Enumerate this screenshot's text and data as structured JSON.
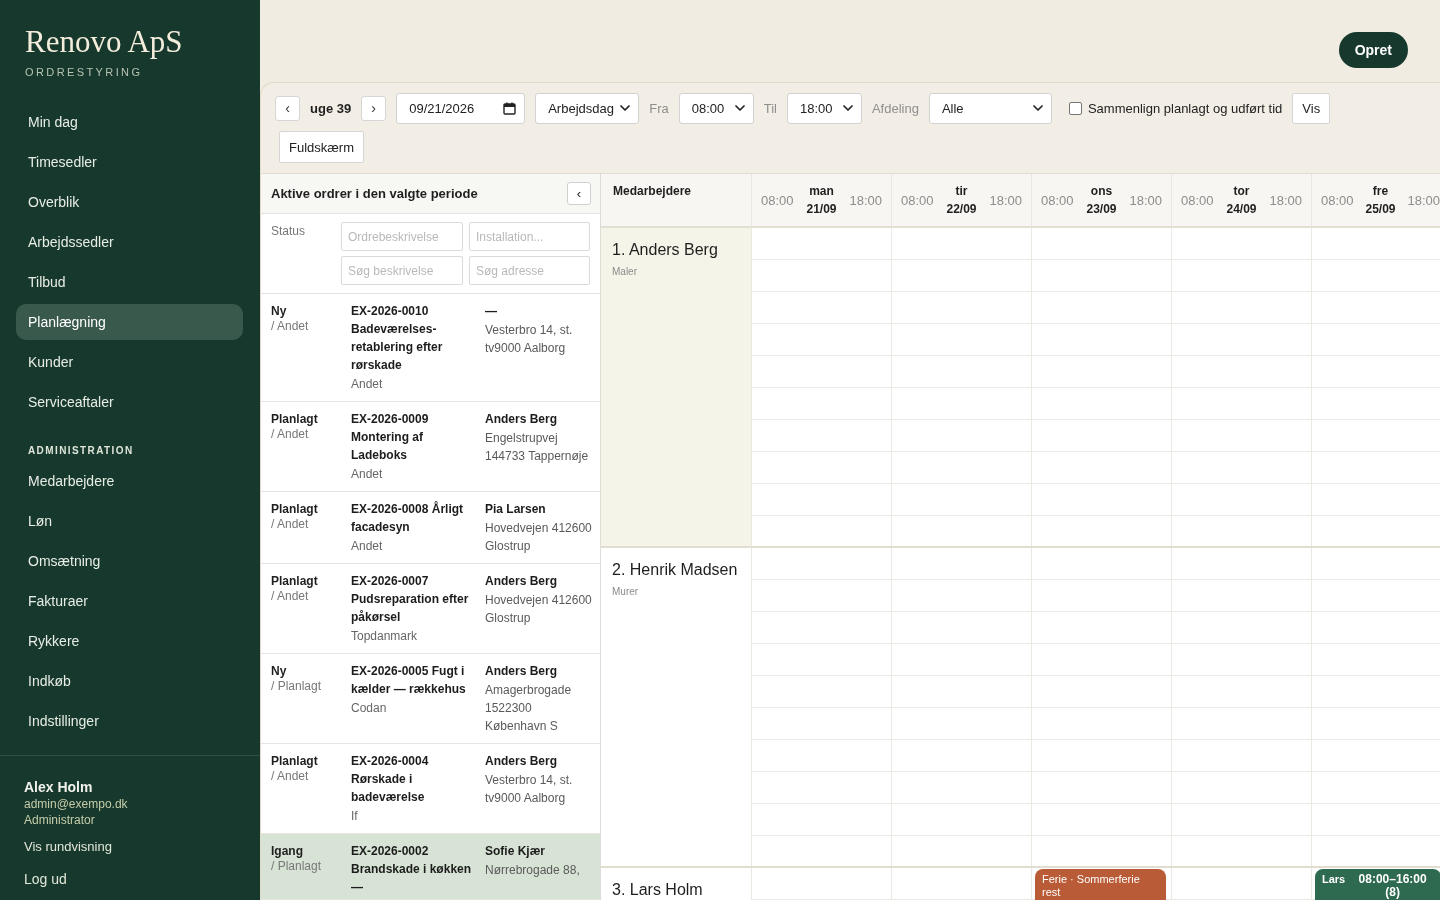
{
  "sidebar": {
    "brand": "Renovo ApS",
    "subtitle": "ORDRESTYRING",
    "nav": [
      {
        "label": "Min dag",
        "selected": false
      },
      {
        "label": "Timesedler",
        "selected": false
      },
      {
        "label": "Overblik",
        "selected": false
      },
      {
        "label": "Arbejdssedler",
        "selected": false
      },
      {
        "label": "Tilbud",
        "selected": false
      },
      {
        "label": "Planlægning",
        "selected": true
      },
      {
        "label": "Kunder",
        "selected": false
      },
      {
        "label": "Serviceaftaler",
        "selected": false
      }
    ],
    "admin_heading": "ADMINISTRATION",
    "admin_nav": [
      {
        "label": "Medarbejdere",
        "selected": false
      },
      {
        "label": "Løn",
        "selected": false
      },
      {
        "label": "Omsætning",
        "selected": false
      },
      {
        "label": "Fakturaer",
        "selected": false
      },
      {
        "label": "Rykkere",
        "selected": false
      },
      {
        "label": "Indkøb",
        "selected": false
      },
      {
        "label": "Indstillinger",
        "selected": false
      }
    ],
    "user": {
      "name": "Alex Holm",
      "email": "admin@exempo.dk",
      "role": "Administrator"
    },
    "links": [
      "Vis rundvisning",
      "Log ud"
    ]
  },
  "header": {
    "create_button": "Opret"
  },
  "toolbar": {
    "prev_week": "‹",
    "week": "uge 39",
    "next_week": "›",
    "date": "09/21/2026",
    "view": "Arbejdsdag",
    "from_label": "Fra",
    "from": "08:00",
    "to_label": "Til",
    "to": "18:00",
    "department_label": "Afdeling",
    "department": "Alle",
    "compare": {
      "label": "Sammenlign planlagt og udført tid",
      "checked": false
    },
    "show_button": "Vis",
    "fullscreen_button": "Fuldskærm"
  },
  "orders_panel": {
    "title": "Aktive ordrer i den valgte periode",
    "collapse": "‹",
    "filters": {
      "status_label": "Status",
      "fields": [
        {
          "placeholder": "Ordrebeskrivelse"
        },
        {
          "placeholder": "Installation..."
        },
        {
          "placeholder": "Søg beskrivelse"
        },
        {
          "placeholder": "Søg adresse"
        }
      ]
    },
    "orders": [
      {
        "status": "Ny",
        "sub_status": "/ Andet",
        "title": "EX-2026-0010 Badeværelses-retablering efter rørskade",
        "customer": "Andet",
        "person": "—",
        "address": "Vesterbro 14, st. tv9000 Aalborg",
        "selected": false
      },
      {
        "status": "Planlagt",
        "sub_status": "/ Andet",
        "title": "EX-2026-0009 Montering af Ladeboks",
        "customer": "Andet",
        "person": "Anders Berg",
        "address": "Engelstrupvej 144733 Tappernøje",
        "selected": false
      },
      {
        "status": "Planlagt",
        "sub_status": "/ Andet",
        "title": "EX-2026-0008 Årligt facadesyn",
        "customer": "Andet",
        "person": "Pia Larsen",
        "address": "Hovedvejen 412600 Glostrup",
        "selected": false
      },
      {
        "status": "Planlagt",
        "sub_status": "/ Andet",
        "title": "EX-2026-0007 Pudsreparation efter påkørsel",
        "customer": "Topdanmark",
        "person": "Anders Berg",
        "address": "Hovedvejen 412600 Glostrup",
        "selected": false
      },
      {
        "status": "Ny",
        "sub_status": "/ Planlagt",
        "title": "EX-2026-0005 Fugt i kælder — rækkehus",
        "customer": "Codan",
        "person": "Anders Berg",
        "address": "Amagerbrogade 1522300 København S",
        "selected": false
      },
      {
        "status": "Planlagt",
        "sub_status": "/ Andet",
        "title": "EX-2026-0004 Rørskade i badeværelse",
        "customer": "If",
        "person": "Anders Berg",
        "address": "Vesterbro 14, st. tv9000 Aalborg",
        "selected": false
      },
      {
        "status": "Igang",
        "sub_status": "/ Planlagt",
        "title": "EX-2026-0002 Brandskade i køkken —",
        "person": "Sofie Kjær",
        "address": "Nørrebrogade 88,",
        "selected": true
      }
    ]
  },
  "schedule": {
    "employee_heading": "Medarbejdere",
    "days": [
      {
        "start": "08:00",
        "name": "man",
        "date": "21/09",
        "end": "18:00"
      },
      {
        "start": "08:00",
        "name": "tir",
        "date": "22/09",
        "end": "18:00"
      },
      {
        "start": "08:00",
        "name": "ons",
        "date": "23/09",
        "end": "18:00"
      },
      {
        "start": "08:00",
        "name": "tor",
        "date": "24/09",
        "end": "18:00"
      },
      {
        "start": "08:00",
        "name": "fre",
        "date": "25/09",
        "end": "18:00"
      }
    ],
    "employees": [
      {
        "name": "1. Anders Berg",
        "role": "Maler",
        "selected": true
      },
      {
        "name": "2. Henrik Madsen",
        "role": "Murer",
        "selected": false
      },
      {
        "name": "3. Lars Holm",
        "selected": false,
        "day_cells": [
          null,
          null,
          {
            "kind": "absence",
            "color": "#b95b36",
            "text": "Ferie · Sommerferie rest"
          },
          null,
          {
            "kind": "shift",
            "color": "#2e6a4f",
            "who": "Lars",
            "time": "08:00–16:00 (8)"
          }
        ]
      }
    ]
  }
}
